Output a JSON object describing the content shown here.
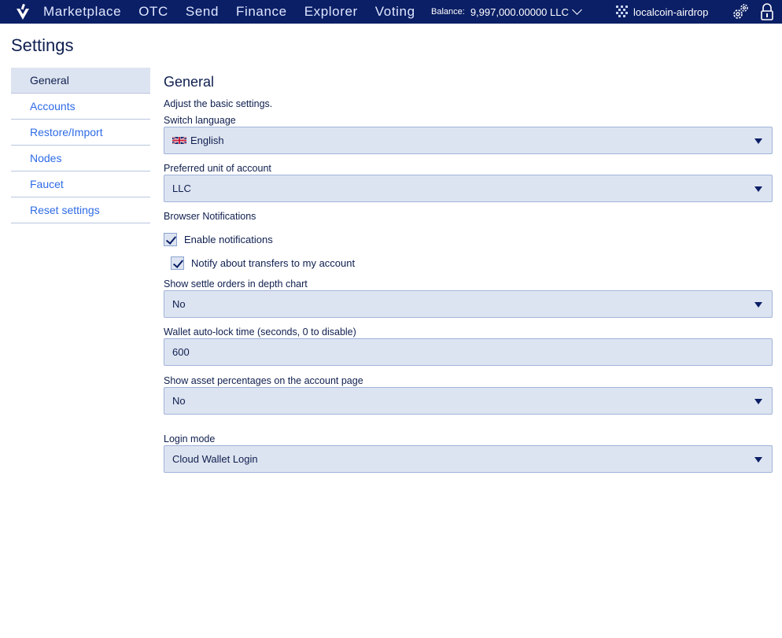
{
  "nav": {
    "items": [
      "Marketplace",
      "OTC",
      "Send",
      "Finance",
      "Explorer",
      "Voting"
    ],
    "balance_label": "Balance:",
    "balance_value": "9,997,000.00000 LLC",
    "account_name": "localcoin-airdrop"
  },
  "page": {
    "title": "Settings"
  },
  "sidebar": {
    "items": [
      "General",
      "Accounts",
      "Restore/Import",
      "Nodes",
      "Faucet",
      "Reset settings"
    ],
    "active": "General"
  },
  "general": {
    "heading": "General",
    "description": "Adjust the basic settings.",
    "language_label": "Switch language",
    "language_value": "English",
    "unit_label": "Preferred unit of account",
    "unit_value": "LLC",
    "notifications_label": "Browser Notifications",
    "enable_notifications": "Enable notifications",
    "notify_transfers": "Notify about transfers to my account",
    "settle_label": "Show settle orders in depth chart",
    "settle_value": "No",
    "autolock_label": "Wallet auto-lock time (seconds, 0 to disable)",
    "autolock_value": "600",
    "percent_label": "Show asset percentages on the account page",
    "percent_value": "No",
    "login_label": "Login mode",
    "login_value": "Cloud Wallet Login"
  },
  "colors": {
    "navbar": "#0b1f66",
    "field_bg": "#dde4f1",
    "link": "#2e6be6",
    "text": "#0f1f4f"
  }
}
